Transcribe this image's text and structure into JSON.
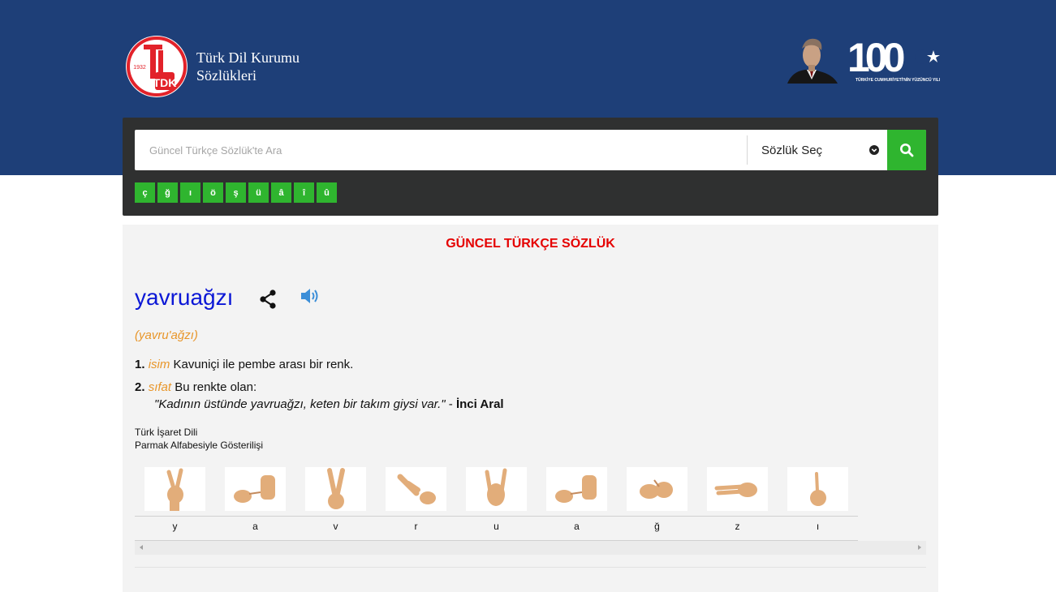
{
  "header": {
    "logo_year": "1932",
    "logo_letters": "TDK",
    "site_title_line1": "Türk Dil Kurumu",
    "site_title_line2": "Sözlükleri",
    "centennial_number": "100",
    "centennial_caption": "TÜRKİYE CUMHURİYETİ'NİN YÜZÜNCÜ YILI"
  },
  "search": {
    "placeholder": "Güncel Türkçe Sözlük'te Ara",
    "dictionary_select_label": "Sözlük Seç",
    "special_chars": [
      "ç",
      "ğ",
      "ı",
      "ö",
      "ş",
      "ü",
      "â",
      "î",
      "û"
    ]
  },
  "dictionary": {
    "heading": "GÜNCEL TÜRKÇE SÖZLÜK",
    "word": "yavruağzı",
    "pronunciation": "(yavru'ağzı)",
    "definitions": [
      {
        "number": "1.",
        "pos": "isim",
        "text": "Kavuniçi ile pembe arası bir renk."
      },
      {
        "number": "2.",
        "pos": "sıfat",
        "text": "Bu renkte olan:"
      }
    ],
    "example": {
      "quote": "\"Kadının üstünde yavruağzı, keten bir takım giysi var.\"",
      "separator": " - ",
      "author": "İnci Aral"
    }
  },
  "sign_language": {
    "title_line1": "Türk İşaret Dili",
    "title_line2": "Parmak Alfabesiyle Gösterilişi",
    "letters": [
      "y",
      "a",
      "v",
      "r",
      "u",
      "a",
      "ğ",
      "z",
      "ı"
    ]
  },
  "colors": {
    "header_blue": "#1e3f78",
    "accent_green": "#2fb52f",
    "heading_red": "#e50000",
    "word_blue": "#0b17d6",
    "pos_orange": "#e8962a",
    "skin": "#e2ad7a"
  }
}
